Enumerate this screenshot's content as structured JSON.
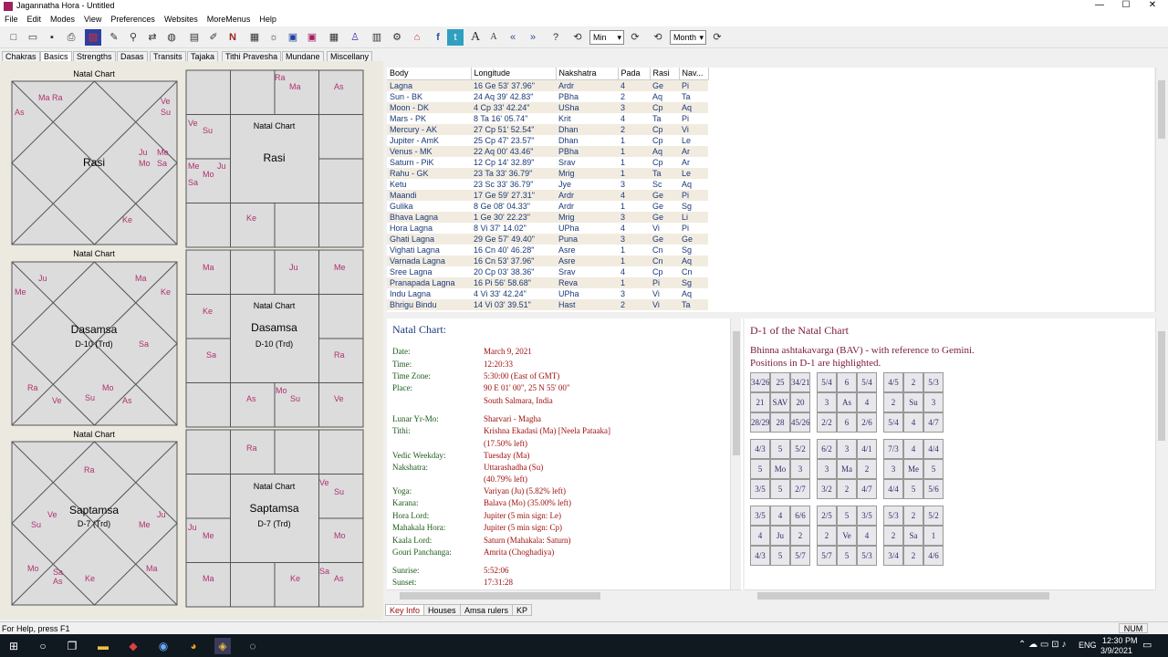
{
  "window": {
    "title": "Jagannatha Hora - Untitled",
    "minimize": "—",
    "maximize": "☐",
    "close": "✕"
  },
  "menu": [
    "File",
    "Edit",
    "Modes",
    "View",
    "Preferences",
    "Websites",
    "MoreMenus",
    "Help"
  ],
  "toolbar": {
    "unit1": "Min",
    "unit2": "Month"
  },
  "tabs": [
    "Chakras",
    "Basics",
    "Strengths",
    "Dasas",
    "Transits",
    "Tajaka",
    "Tithi Pravesha",
    "Mundane",
    "Miscellany"
  ],
  "charts": [
    {
      "title": "Natal Chart",
      "name": "Rasi",
      "sub": "",
      "placements": [
        [
          "Ma Ra",
          42,
          102
        ],
        [
          "As",
          16,
          118
        ],
        [
          "Ve",
          176,
          106
        ],
        [
          "Su",
          176,
          118
        ],
        [
          "Ju",
          152,
          162
        ],
        [
          "Me",
          172,
          162
        ],
        [
          "Mo",
          152,
          174
        ],
        [
          "Sa",
          172,
          174
        ],
        [
          "Ke",
          134,
          236
        ]
      ],
      "placements2": [
        [
          "Ra",
          301,
          80
        ],
        [
          "Ma",
          317,
          90
        ],
        [
          "As",
          366,
          90
        ],
        [
          "Ve",
          206,
          130
        ],
        [
          "Su",
          222,
          138
        ],
        [
          "Me",
          206,
          177
        ],
        [
          "Ju",
          238,
          177
        ],
        [
          "Mo",
          222,
          186
        ],
        [
          "Sa",
          206,
          195
        ],
        [
          "Ke",
          270,
          234
        ]
      ]
    },
    {
      "title": "Natal Chart",
      "name": "Dasamsa",
      "sub": "D-10 (Trd)",
      "placements": [
        [
          "Ju",
          42,
          300
        ],
        [
          "Ma",
          148,
          300
        ],
        [
          "Me",
          16,
          315
        ],
        [
          "Ke",
          176,
          315
        ],
        [
          "Sa",
          152,
          372
        ],
        [
          "Ra",
          30,
          420
        ],
        [
          "Ve",
          57,
          434
        ],
        [
          "Mo",
          112,
          420
        ],
        [
          "Su",
          93,
          431
        ],
        [
          "As",
          134,
          434
        ]
      ],
      "placements2": [
        [
          "Ma",
          222,
          288
        ],
        [
          "Ju",
          317,
          288
        ],
        [
          "Me",
          366,
          288
        ],
        [
          "Ke",
          222,
          336
        ],
        [
          "Sa",
          226,
          384
        ],
        [
          "Ra",
          366,
          384
        ],
        [
          "Mo",
          302,
          423
        ],
        [
          "As",
          270,
          432
        ],
        [
          "Su",
          318,
          432
        ],
        [
          "Ve",
          366,
          432
        ]
      ]
    },
    {
      "title": "Natal Chart",
      "name": "Saptamsa",
      "sub": "D-7 (Trd)",
      "placements": [
        [
          "Ra",
          92,
          510
        ],
        [
          "Ve",
          52,
          559
        ],
        [
          "Ju",
          172,
          559
        ],
        [
          "Su",
          34,
          570
        ],
        [
          "Me",
          152,
          570
        ],
        [
          "Mo",
          30,
          618
        ],
        [
          "Sa",
          58,
          622
        ],
        [
          "As",
          58,
          632
        ],
        [
          "Ke",
          93,
          629
        ],
        [
          "Ma",
          160,
          618
        ]
      ],
      "placements2": [
        [
          "Ra",
          270,
          486
        ],
        [
          "Ve",
          350,
          524
        ],
        [
          "Su",
          366,
          534
        ],
        [
          "Ju",
          206,
          573
        ],
        [
          "Me",
          222,
          582
        ],
        [
          "Mo",
          366,
          582
        ],
        [
          "Sa",
          350,
          621
        ],
        [
          "Ma",
          222,
          629
        ],
        [
          "Ke",
          318,
          629
        ],
        [
          "As",
          366,
          629
        ]
      ]
    }
  ],
  "table": {
    "headers": [
      "Body",
      "Longitude",
      "Nakshatra",
      "Pada",
      "Rasi",
      "Nav..."
    ],
    "rows": [
      [
        "Lagna",
        "16 Ge 53' 37.96\"",
        "Ardr",
        "4",
        "Ge",
        "Pi"
      ],
      [
        "Sun - BK",
        "24 Aq 39' 42.83\"",
        "PBha",
        "2",
        "Aq",
        "Ta"
      ],
      [
        "Moon - DK",
        "4 Cp 33' 42.24\"",
        "USha",
        "3",
        "Cp",
        "Aq"
      ],
      [
        "Mars - PK",
        "8 Ta 16' 05.74\"",
        "Krit",
        "4",
        "Ta",
        "Pi"
      ],
      [
        "Mercury - AK",
        "27 Cp 51' 52.54\"",
        "Dhan",
        "2",
        "Cp",
        "Vi"
      ],
      [
        "Jupiter - AmK",
        "25 Cp 47' 23.57\"",
        "Dhan",
        "1",
        "Cp",
        "Le"
      ],
      [
        "Venus - MK",
        "22 Aq 00' 43.46\"",
        "PBha",
        "1",
        "Aq",
        "Ar"
      ],
      [
        "Saturn - PiK",
        "12 Cp 14' 32.89\"",
        "Srav",
        "1",
        "Cp",
        "Ar"
      ],
      [
        "Rahu - GK",
        "23 Ta 33' 36.79\"",
        "Mrig",
        "1",
        "Ta",
        "Le"
      ],
      [
        "Ketu",
        "23 Sc 33' 36.79\"",
        "Jye",
        "3",
        "Sc",
        "Aq"
      ],
      [
        "Maandi",
        "17 Ge 59' 27.31\"",
        "Ardr",
        "4",
        "Ge",
        "Pi"
      ],
      [
        "Gulika",
        "8 Ge 08' 04.33\"",
        "Ardr",
        "1",
        "Ge",
        "Sg"
      ],
      [
        "Bhava Lagna",
        "1 Ge 30' 22.23\"",
        "Mrig",
        "3",
        "Ge",
        "Li"
      ],
      [
        "Hora Lagna",
        "8 Vi 37' 14.02\"",
        "UPha",
        "4",
        "Vi",
        "Pi"
      ],
      [
        "Ghati Lagna",
        "29 Ge 57' 49.40\"",
        "Puna",
        "3",
        "Ge",
        "Ge"
      ],
      [
        "Vighati Lagna",
        "16 Cn 40' 46.28\"",
        "Asre",
        "1",
        "Cn",
        "Sg"
      ],
      [
        "Varnada Lagna",
        "16 Cn 53' 37.96\"",
        "Asre",
        "1",
        "Cn",
        "Aq"
      ],
      [
        "Sree Lagna",
        "20 Cp 03' 38.36\"",
        "Srav",
        "4",
        "Cp",
        "Cn"
      ],
      [
        "Pranapada Lagna",
        "16 Pi 56' 58.68\"",
        "Reva",
        "1",
        "Pi",
        "Sg"
      ],
      [
        "Indu Lagna",
        "4 Vi 33' 42.24\"",
        "UPha",
        "3",
        "Vi",
        "Aq"
      ],
      [
        "Bhrigu Bindu",
        "14 Vi 03' 39.51\"",
        "Hast",
        "2",
        "Vi",
        "Ta"
      ]
    ]
  },
  "keyinfo": {
    "heading": "Natal Chart:",
    "rows": [
      [
        "Date:",
        "March 9, 2021"
      ],
      [
        "Time:",
        "12:20:33"
      ],
      [
        "Time Zone:",
        "5:30:00 (East of GMT)"
      ],
      [
        "Place:",
        "90 E 01' 00\", 25 N 55' 00\""
      ],
      [
        "",
        "South Salmara, India"
      ],
      [
        "Lunar Yr-Mo:",
        "Sharvari - Magha"
      ],
      [
        "Tithi:",
        "Krishna Ekadasi (Ma) [Neela Pataaka]"
      ],
      [
        "",
        "(17.50% left)"
      ],
      [
        "Vedic Weekday:",
        "Tuesday (Ma)"
      ],
      [
        "Nakshatra:",
        "Uttarashadha (Su)"
      ],
      [
        "",
        "(40.79% left)"
      ],
      [
        "Yoga:",
        "Variyan (Ju) (5.82% left)"
      ],
      [
        "Karana:",
        "Balava (Mo) (35.00% left)"
      ],
      [
        "Hora Lord:",
        "Jupiter (5 min sign: Le)"
      ],
      [
        "Mahakala Hora:",
        "Jupiter (5 min sign: Cp)"
      ],
      [
        "Kaala Lord:",
        "Saturn (Mahakala: Saturn)"
      ],
      [
        "Gouri Panchanga:",
        "Amrita (Choghadiya)"
      ],
      [
        "Sunrise:",
        "5:52:06"
      ],
      [
        "Sunset:",
        "17:31:28"
      ]
    ]
  },
  "bav": {
    "heading": "D-1 of the Natal Chart",
    "line1": "Bhinna ashtakavarga (BAV) - with reference to Gemini.",
    "line2": "Positions in D-1 are highlighted.",
    "grids": [
      [
        "34/26",
        "25",
        "34/21",
        "21",
        "SAV",
        "20",
        "28/29",
        "28",
        "45/26"
      ],
      [
        "5/4",
        "6",
        "5/4",
        "3",
        "As",
        "4",
        "2/2",
        "6",
        "2/6"
      ],
      [
        "4/5",
        "2",
        "5/3",
        "2",
        "Su",
        "3",
        "5/4",
        "4",
        "4/7"
      ],
      [
        "4/3",
        "5",
        "5/2",
        "5",
        "Mo",
        "3",
        "3/5",
        "5",
        "2/7"
      ],
      [
        "6/2",
        "3",
        "4/1",
        "3",
        "Ma",
        "2",
        "3/2",
        "2",
        "4/7"
      ],
      [
        "7/3",
        "4",
        "4/4",
        "3",
        "Me",
        "5",
        "4/4",
        "5",
        "5/6"
      ],
      [
        "3/5",
        "4",
        "6/6",
        "4",
        "Ju",
        "2",
        "4/3",
        "5",
        "5/7"
      ],
      [
        "2/5",
        "5",
        "3/5",
        "2",
        "Ve",
        "4",
        "5/7",
        "5",
        "5/3"
      ],
      [
        "5/3",
        "2",
        "5/2",
        "2",
        "Sa",
        "1",
        "3/4",
        "2",
        "4/6"
      ]
    ]
  },
  "bottomtabs": [
    "Key Info",
    "Houses",
    "Amsa rulers",
    "KP"
  ],
  "status": {
    "help": "For Help, press F1",
    "num": "NUM"
  },
  "taskbar": {
    "time": "12:30 PM",
    "date": "3/9/2021",
    "lang": "ENG"
  }
}
